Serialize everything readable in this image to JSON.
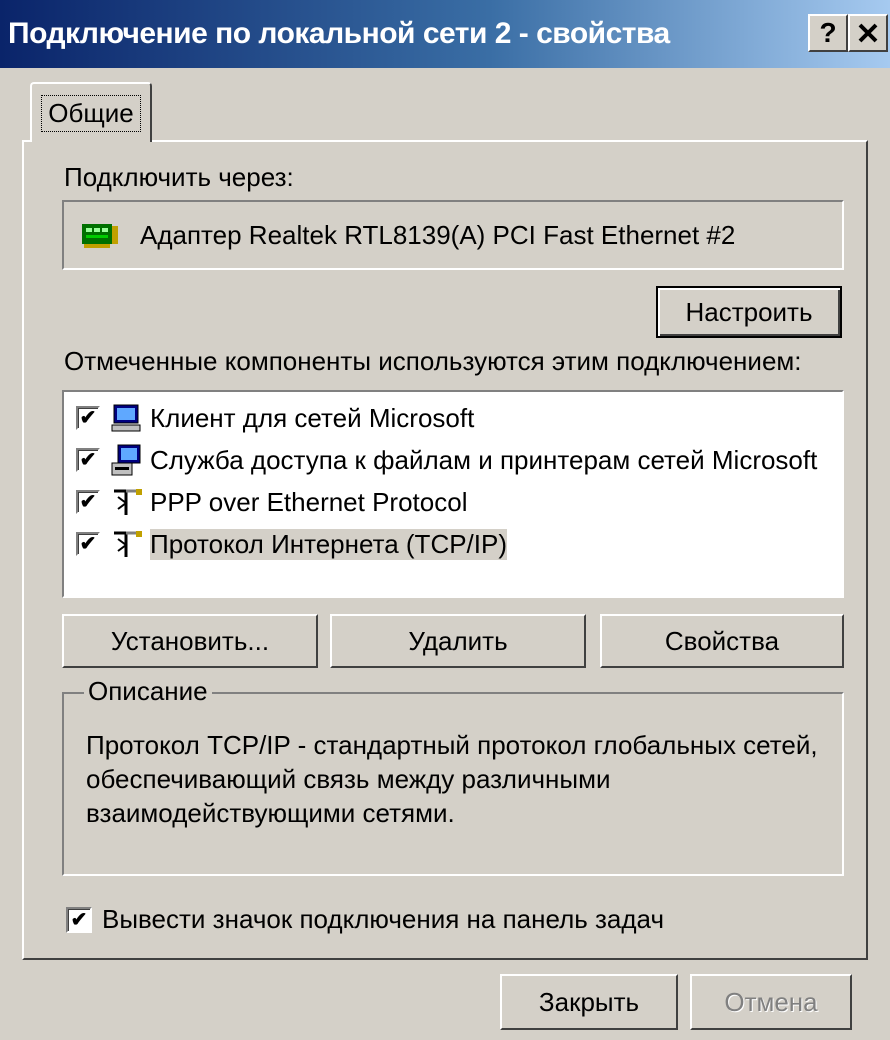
{
  "window": {
    "title": "Подключение по локальной сети 2 - свойства",
    "help_button": "?",
    "close_button": "×"
  },
  "tabs": [
    {
      "label": "Общие",
      "active": true
    }
  ],
  "connect_via": {
    "label": "Подключить через:",
    "adapter": "Адаптер Realtek RTL8139(A) PCI Fast Ethernet #2",
    "configure_button": "Настроить"
  },
  "components": {
    "label": "Отмеченные компоненты используются этим подключением:",
    "items": [
      {
        "label": "Клиент для сетей Microsoft",
        "checked": true,
        "icon": "network-client-icon"
      },
      {
        "label": "Служба доступа к файлам и принтерам сетей Microsoft",
        "checked": true,
        "icon": "file-print-service-icon"
      },
      {
        "label": "PPP over Ethernet Protocol",
        "checked": true,
        "icon": "protocol-icon"
      },
      {
        "label": "Протокол Интернета (TCP/IP)",
        "checked": true,
        "icon": "protocol-icon",
        "selected": true
      }
    ],
    "install_button": "Установить...",
    "remove_button": "Удалить",
    "properties_button": "Свойства"
  },
  "description": {
    "legend": "Описание",
    "text": "Протокол TCP/IP - стандартный протокол глобальных сетей, обеспечивающий связь между различными взаимодействующими сетями."
  },
  "taskbar_icon": {
    "label": "Вывести значок подключения на панель задач",
    "checked": true
  },
  "footer": {
    "close_button": "Закрыть",
    "cancel_button": "Отмена"
  },
  "colors": {
    "title_start": "#0a246a",
    "title_end": "#a6caf0",
    "face": "#d4d0c8"
  }
}
